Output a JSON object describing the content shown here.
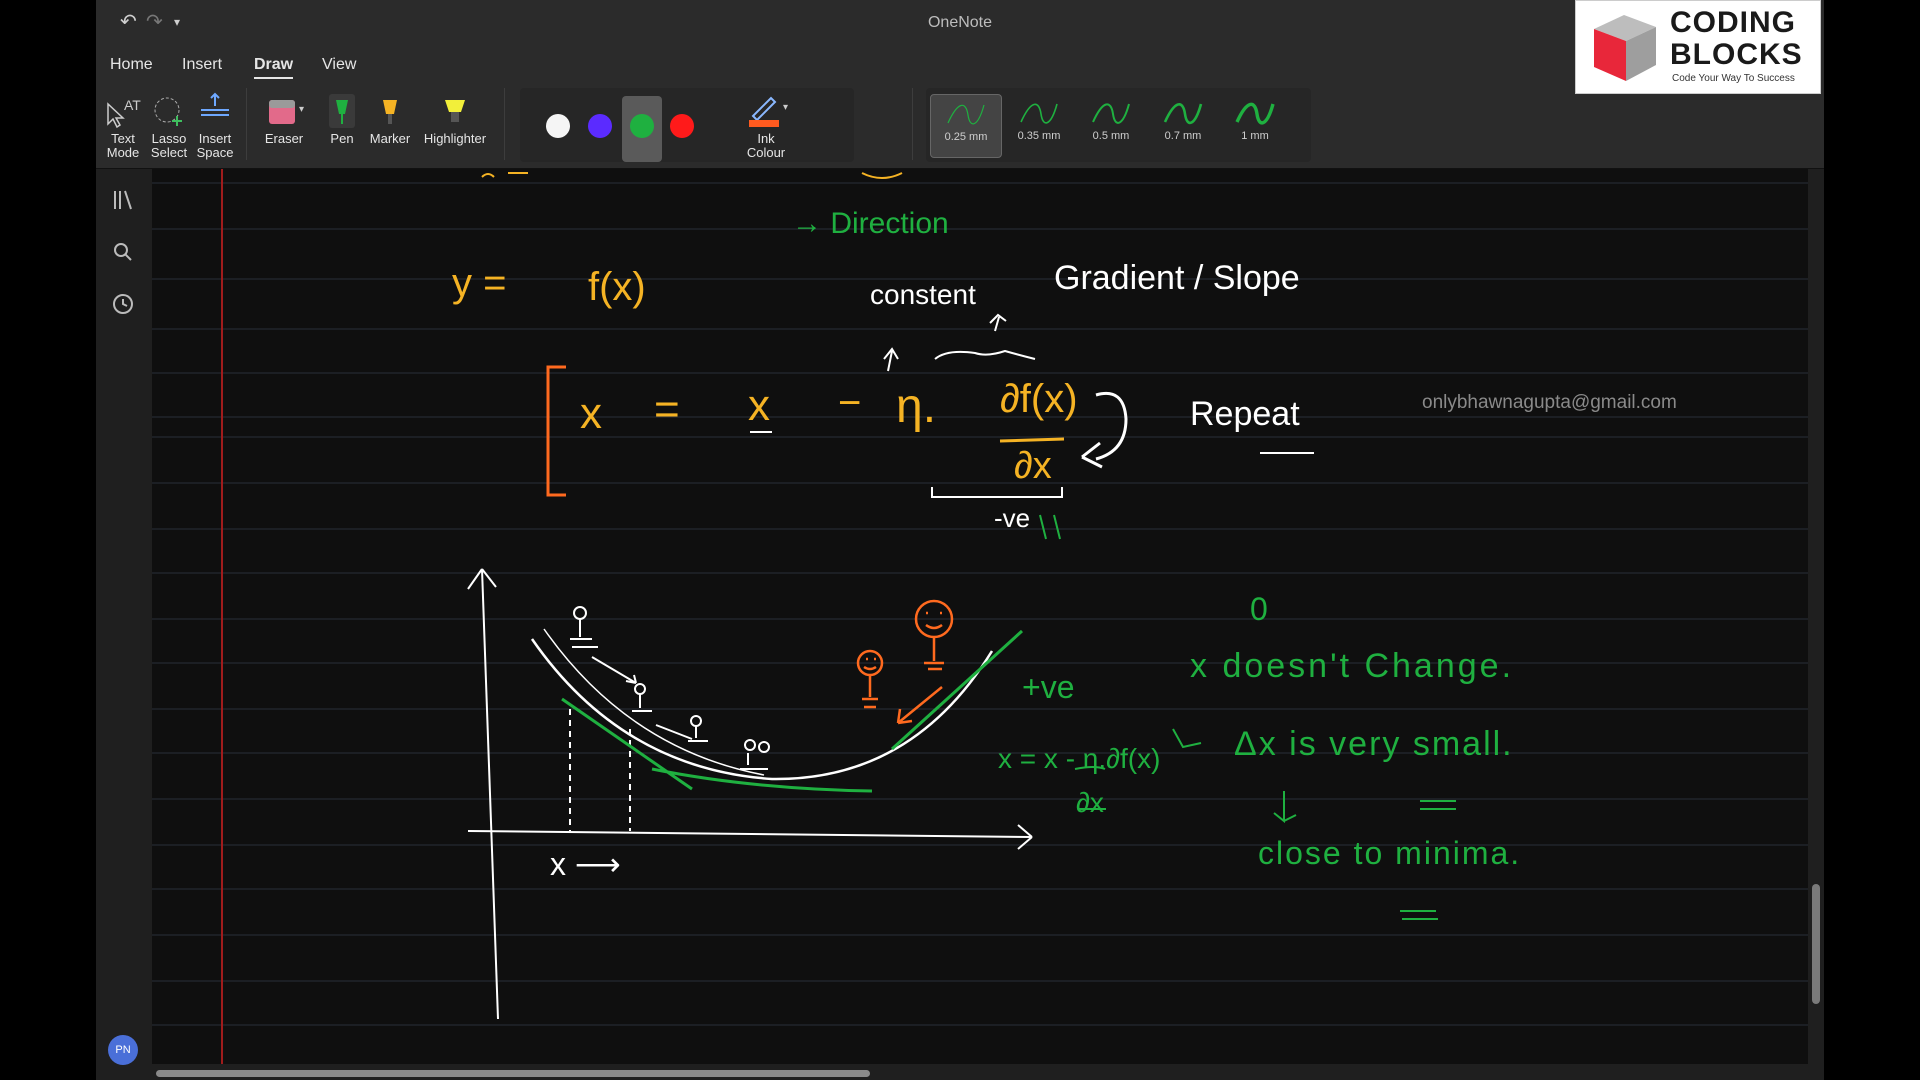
{
  "window": {
    "title": "OneNote"
  },
  "quick_access": {
    "undo_icon": "undo-icon",
    "redo_icon": "redo-icon",
    "customize_icon": "chevron-down-icon"
  },
  "menu": {
    "items": [
      "Home",
      "Insert",
      "Draw",
      "View"
    ],
    "active": "Draw"
  },
  "ribbon": {
    "text_mode": "Text\nMode",
    "lasso_select": "Lasso\nSelect",
    "insert_space": "Insert\nSpace",
    "eraser": "Eraser",
    "pen": "Pen",
    "marker": "Marker",
    "highlighter": "Highlighter",
    "ink_colour": "Ink\nColour",
    "colors": [
      "#f5f5f5",
      "#5b2bff",
      "#1fb040",
      "#ff1a1a"
    ],
    "selected_color": "#1fb040",
    "thickness": [
      "0.25 mm",
      "0.35 mm",
      "0.5 mm",
      "0.7 mm",
      "1 mm"
    ],
    "selected_thickness": "0.25 mm"
  },
  "logo": {
    "line1": "CODING",
    "line2": "BLOCKS",
    "tagline": "Code Your Way To Success"
  },
  "watermark": "onlybhawnagupta@gmail.com",
  "avatar": {
    "initials": "PN"
  },
  "notes": {
    "direction": "→ Direction",
    "y_equals": "y  =",
    "fx": "f(x)",
    "constant": "constent",
    "gradient": "Gradient / Slope",
    "eq_x": "x",
    "eq_equals": "=",
    "eq_x2": "x",
    "eq_minus": "−",
    "eta": "η.",
    "partial_fx": "∂f(x)",
    "partial_x": "∂x",
    "neg_ve": "-ve",
    "repeat": "Repeat",
    "parallel": "\\\\",
    "zero": "0",
    "x_no_change": "x  doesn't  Change.",
    "delta": "Δx  is very small.",
    "minima": "close to  minima.",
    "pos_ve": "+ve",
    "green_eq": "x = x - η.∂f(x)",
    "green_den": "∂x",
    "x_axis": "x ⟶"
  }
}
